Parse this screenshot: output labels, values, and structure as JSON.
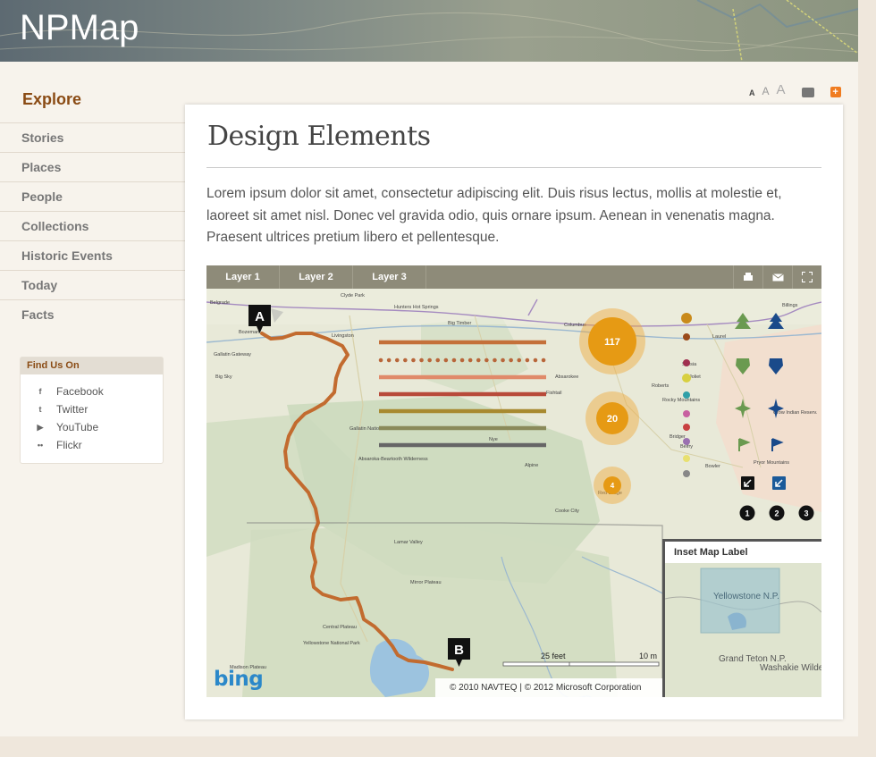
{
  "header": {
    "logo": "NPMap"
  },
  "sidebar": {
    "title": "Explore",
    "items": [
      {
        "label": "Stories"
      },
      {
        "label": "Places"
      },
      {
        "label": "People"
      },
      {
        "label": "Collections"
      },
      {
        "label": "Historic Events"
      },
      {
        "label": "Today"
      },
      {
        "label": "Facts"
      }
    ],
    "find_us": {
      "title": "Find Us On",
      "links": [
        {
          "label": "Facebook",
          "icon": "facebook-icon",
          "glyph": "f"
        },
        {
          "label": "Twitter",
          "icon": "twitter-icon",
          "glyph": "t"
        },
        {
          "label": "YouTube",
          "icon": "youtube-icon",
          "glyph": "▶"
        },
        {
          "label": "Flickr",
          "icon": "flickr-icon",
          "glyph": "••"
        }
      ]
    }
  },
  "tools": {
    "font_small": "A",
    "font_medium": "A",
    "font_large": "A",
    "add": "+"
  },
  "content": {
    "title": "Design Elements",
    "paragraph": "Lorem ipsum dolor sit amet, consectetur adipiscing elit. Duis risus lectus, mollis at molestie et, laoreet sit amet nisl. Donec vel gravida odio, quis ornare ipsum. Aenean in venenatis magna. Praesent ultrices pretium libero et pellentesque."
  },
  "map": {
    "tabs": [
      {
        "label": "Layer 1"
      },
      {
        "label": "Layer 2"
      },
      {
        "label": "Layer 3"
      }
    ],
    "tools": [
      "print-icon",
      "mail-icon",
      "fullscreen-icon"
    ],
    "markers": {
      "start": "A",
      "end": "B"
    },
    "clusters": [
      {
        "count": "117"
      },
      {
        "count": "20"
      },
      {
        "count": "4"
      }
    ],
    "numbered_markers": [
      "1",
      "2",
      "3"
    ],
    "place_labels": [
      "Belgrade",
      "Bozeman",
      "Livingston",
      "Clyde Park",
      "Hunters Hot Springs",
      "Big Timber",
      "Billings",
      "Laurel",
      "Absarokee",
      "Fishtail",
      "Columbus",
      "Gallatin National Forest",
      "Absaroka-Beartooth Wilderness",
      "Lamar Valley",
      "Mirror Plateau",
      "Central Plateau",
      "Yellowstone National Park",
      "Madison Plateau",
      "Red Lodge",
      "Bridger",
      "Pryor Mountains",
      "Crow Indian Reserv.",
      "Rocky Mountains",
      "Cooke City",
      "Alpine",
      "Nye",
      "Silesia",
      "Joliet",
      "Roberts",
      "Belfry",
      "Bowler",
      "Gallatin Gateway",
      "Big Sky"
    ],
    "route_color": "#c26b2f",
    "line_styles": [
      "#c4703a",
      "#b8663a",
      "#e08a6a",
      "#b84a3a",
      "#a88a30",
      "#8a8a5a",
      "#666666"
    ],
    "scale_labels": [
      "25 feet",
      "10 m"
    ],
    "credit": "© 2010 NAVTEQ | © 2012 Microsoft Corporation",
    "provider": "bing",
    "inset": {
      "label": "Inset Map Label",
      "places": [
        "Yellowstone N.P.",
        "Grand Teton N.P.",
        "Washakie Wilderness"
      ]
    }
  }
}
